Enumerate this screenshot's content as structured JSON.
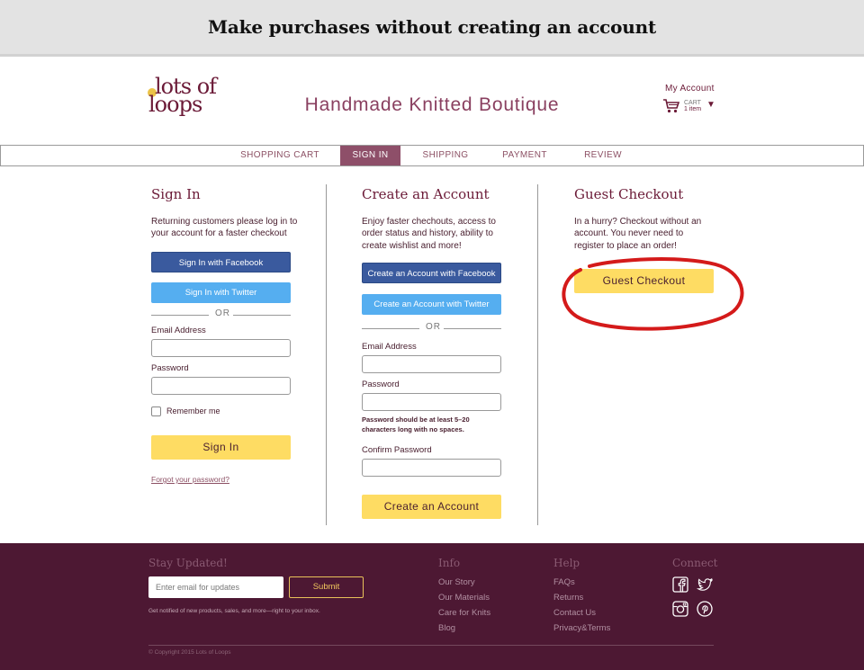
{
  "banner": {
    "title": "Make purchases without creating an account"
  },
  "header": {
    "logo_line1": "lots of",
    "logo_line2": "loops",
    "site_title": "Handmade Knitted Boutique",
    "my_account": "My Account",
    "cart_label": "CART",
    "cart_count": "1 item"
  },
  "steps": [
    {
      "label": "SHOPPING CART",
      "active": false
    },
    {
      "label": "SIGN IN",
      "active": true
    },
    {
      "label": "SHIPPING",
      "active": false
    },
    {
      "label": "PAYMENT",
      "active": false
    },
    {
      "label": "REVIEW",
      "active": false
    }
  ],
  "signin": {
    "title": "Sign In",
    "text": "Returning customers please log in to your account for a faster checkout",
    "facebook": "Sign In with Facebook",
    "twitter": "Sign In with Twitter",
    "or": "OR",
    "email_label": "Email Address",
    "password_label": "Password",
    "remember": "Remember me",
    "submit": "Sign In",
    "forgot": "Forgot your password?"
  },
  "create": {
    "title": "Create an Account",
    "text": "Enjoy faster chechouts, access to order status and history, ability to create wishlist and more!",
    "facebook": "Create an Account with Facebook",
    "twitter": "Create an Account with Twitter",
    "or": "OR",
    "email_label": "Email Address",
    "password_label": "Password",
    "password_hint": "Password should be at least 5–20 characters long with no spaces.",
    "confirm_label": "Confirm Password",
    "submit": "Create an Account"
  },
  "guest": {
    "title": "Guest Checkout",
    "text": "In a hurry? Checkout without an account. You never need to register to place an order!",
    "button": "Guest Checkout"
  },
  "footer": {
    "stay_title": "Stay Updated!",
    "email_placeholder": "Enter email for updates",
    "submit": "Submit",
    "note": "Get notified of new products, sales, and more—right to your inbox.",
    "info_title": "Info",
    "info_links": [
      "Our Story",
      "Our Materials",
      "Care for Knits",
      "Blog"
    ],
    "help_title": "Help",
    "help_links": [
      "FAQs",
      "Returns",
      "Contact Us",
      "Privacy&Terms"
    ],
    "connect_title": "Connect",
    "social_icons": [
      "facebook-icon",
      "twitter-icon",
      "instagram-icon",
      "pinterest-icon"
    ],
    "copyright": "© Copyright 2015 Lots of Loops"
  },
  "colors": {
    "brand": "#6b1a37",
    "accent_yellow": "#fedc63",
    "footer_bg": "#4d1833",
    "facebook": "#3a5a9e",
    "twitter": "#55aef0",
    "annotation_red": "#d41a1a"
  }
}
